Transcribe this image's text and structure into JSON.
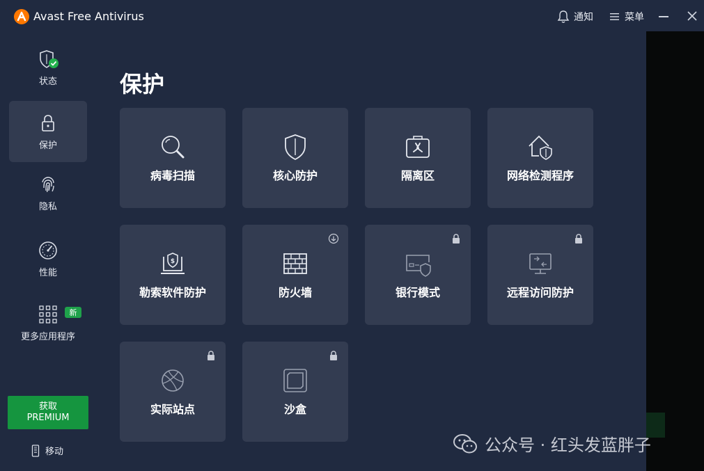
{
  "titlebar": {
    "app_name": "Avast Free Antivirus",
    "notify_label": "通知",
    "menu_label": "菜单"
  },
  "sidebar": {
    "items": [
      {
        "label": "状态",
        "icon": "shield-check-icon"
      },
      {
        "label": "保护",
        "icon": "lock-icon",
        "active": true
      },
      {
        "label": "隐私",
        "icon": "fingerprint-icon"
      },
      {
        "label": "性能",
        "icon": "speedometer-icon"
      },
      {
        "label": "更多应用程序",
        "icon": "grid-icon",
        "badge": "新"
      }
    ],
    "premium": {
      "line1": "获取",
      "line2": "PREMIUM"
    },
    "mobile_label": "移动"
  },
  "main": {
    "title": "保护",
    "tiles": [
      {
        "label": "病毒扫描",
        "icon": "magnifier-icon"
      },
      {
        "label": "核心防护",
        "icon": "shield-icon"
      },
      {
        "label": "隔离区",
        "icon": "quarantine-case-icon"
      },
      {
        "label": "网络检测程序",
        "icon": "home-shield-icon"
      },
      {
        "label": "勒索软件防护",
        "icon": "ransomware-laptop-icon"
      },
      {
        "label": "防火墙",
        "icon": "brick-wall-icon",
        "corner": "download-icon"
      },
      {
        "label": "银行模式",
        "icon": "card-shield-icon",
        "corner": "lock-icon"
      },
      {
        "label": "远程访问防护",
        "icon": "remote-screen-icon",
        "corner": "lock-icon"
      },
      {
        "label": "实际站点",
        "icon": "globe-icon",
        "corner": "lock-icon"
      },
      {
        "label": "沙盒",
        "icon": "sandbox-icon",
        "corner": "lock-icon"
      }
    ]
  },
  "watermark": "公众号 · 红头发蓝胖子",
  "colors": {
    "window_bg": "#202a40",
    "tile_bg": "#333c51",
    "active_nav_bg": "#323b50",
    "premium_green": "#15953f",
    "logo_orange": "#ff7800",
    "check_green": "#23b14d"
  }
}
